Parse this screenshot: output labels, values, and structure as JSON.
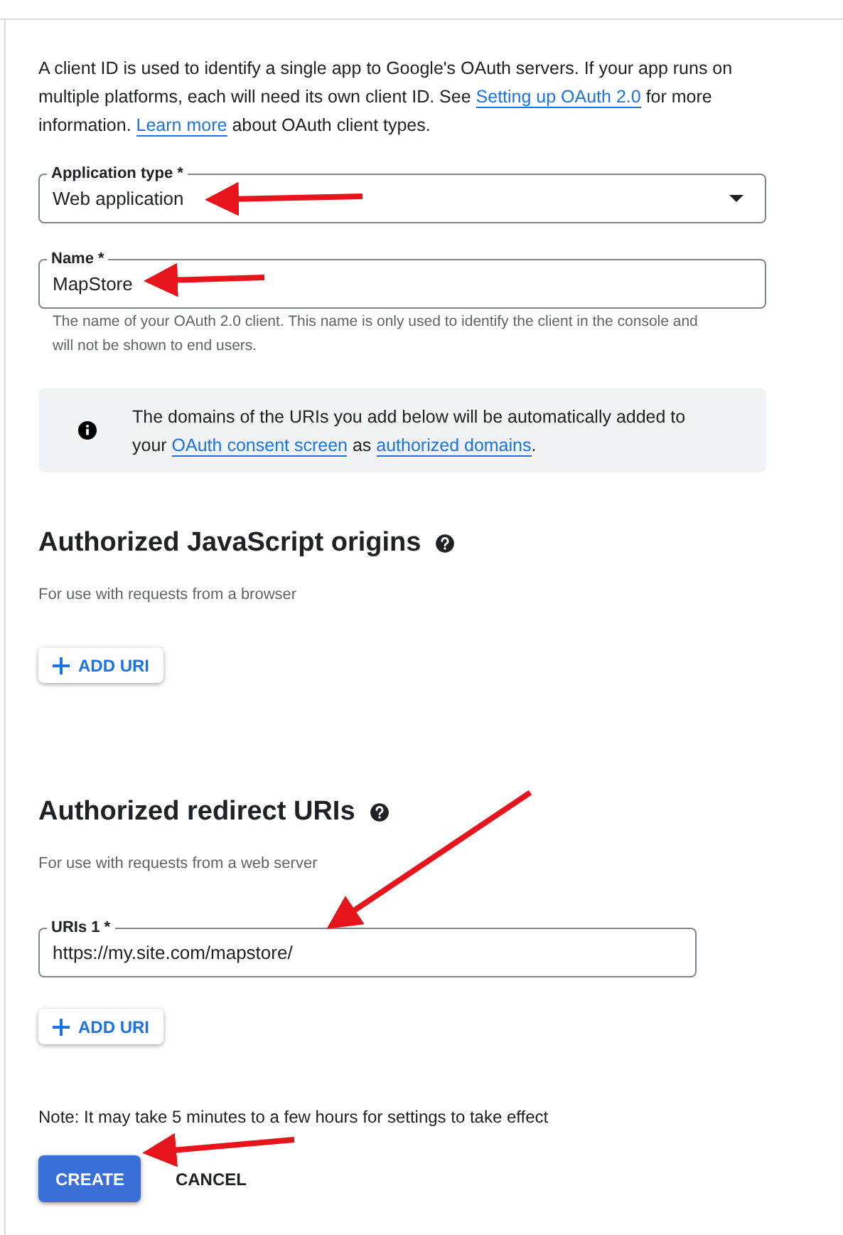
{
  "intro": [
    {
      "kind": "text",
      "text": "A client ID is used to identify a single app to Google's OAuth servers. If your app runs on multiple platforms, each will need its own client ID. See "
    },
    {
      "kind": "link",
      "text": "Setting up OAuth 2.0"
    },
    {
      "kind": "text",
      "text": " for more information. "
    },
    {
      "kind": "link",
      "text": "Learn more"
    },
    {
      "kind": "text",
      "text": " about OAuth client types."
    }
  ],
  "application_type": {
    "label": "Application type *",
    "value": "Web application"
  },
  "name_field": {
    "label": "Name *",
    "value": "MapStore",
    "helper": "The name of your OAuth 2.0 client. This name is only used to identify the client in the console and will not be shown to end users."
  },
  "info": [
    {
      "kind": "text",
      "text": "The domains of the URIs you add below will be automatically added to your "
    },
    {
      "kind": "link",
      "text": "OAuth consent screen"
    },
    {
      "kind": "text",
      "text": " as "
    },
    {
      "kind": "link",
      "text": "authorized domains"
    },
    {
      "kind": "text",
      "text": "."
    }
  ],
  "sections": [
    {
      "title": "Authorized JavaScript origins",
      "subtitle": "For use with requests from a browser",
      "add_button": "ADD URI"
    },
    {
      "title": "Authorized redirect URIs",
      "subtitle": "For use with requests from a web server",
      "uris": [
        {
          "label": "URIs 1 *",
          "value": "https://my.site.com/mapstore/"
        }
      ],
      "add_button": "ADD URI"
    }
  ],
  "note": "Note: It may take 5 minutes to a few hours for settings to take effect",
  "buttons": [
    {
      "kind": "primary",
      "label": "CREATE"
    },
    {
      "kind": "text",
      "label": "CANCEL"
    }
  ]
}
